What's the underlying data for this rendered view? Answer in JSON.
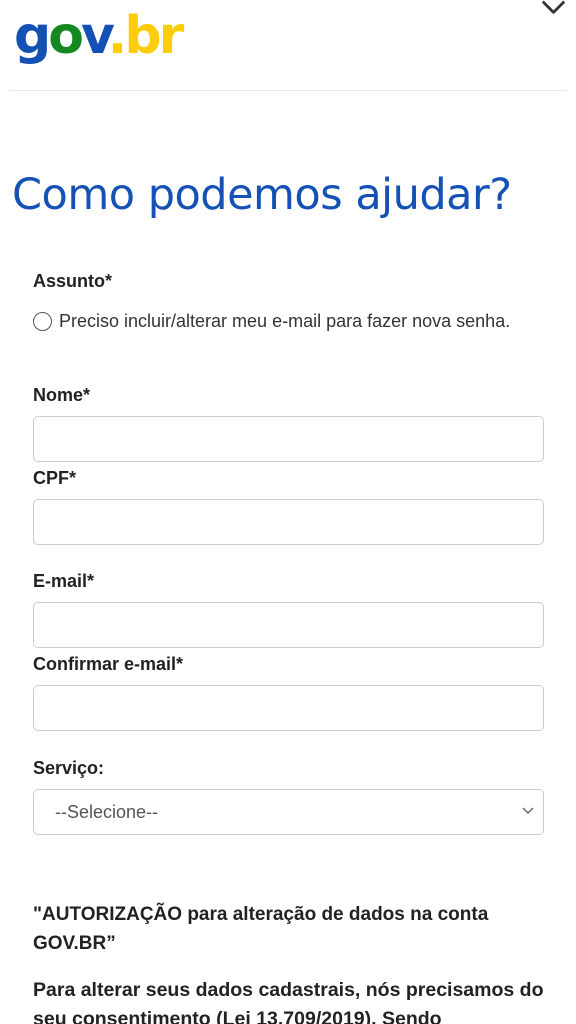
{
  "header": {
    "logo_parts": {
      "g": "g",
      "o": "o",
      "v": "v",
      "dot": ".",
      "br": "br"
    }
  },
  "page_title": "Como podemos ajudar?",
  "form": {
    "assunto_label": "Assunto*",
    "assunto_option": "Preciso incluir/alterar meu e-mail para fazer nova senha.",
    "nome_label": "Nome*",
    "nome_value": "",
    "cpf_label": "CPF*",
    "cpf_value": "",
    "email_label": "E-mail*",
    "email_value": "",
    "confirm_email_label": "Confirmar e-mail*",
    "confirm_email_value": "",
    "servico_label": "Serviço:",
    "servico_selected": "--Selecione--"
  },
  "authorization": {
    "title": "\"AUTORIZAÇÃO para alteração de dados na conta GOV.BR”",
    "body": "Para alterar seus dados cadastrais, nós precisamos do seu consentimento (Lei 13.709/2019). Sendo"
  },
  "colors": {
    "brand_blue": "#1351b4",
    "brand_green": "#168821",
    "brand_yellow": "#ffcd07"
  }
}
